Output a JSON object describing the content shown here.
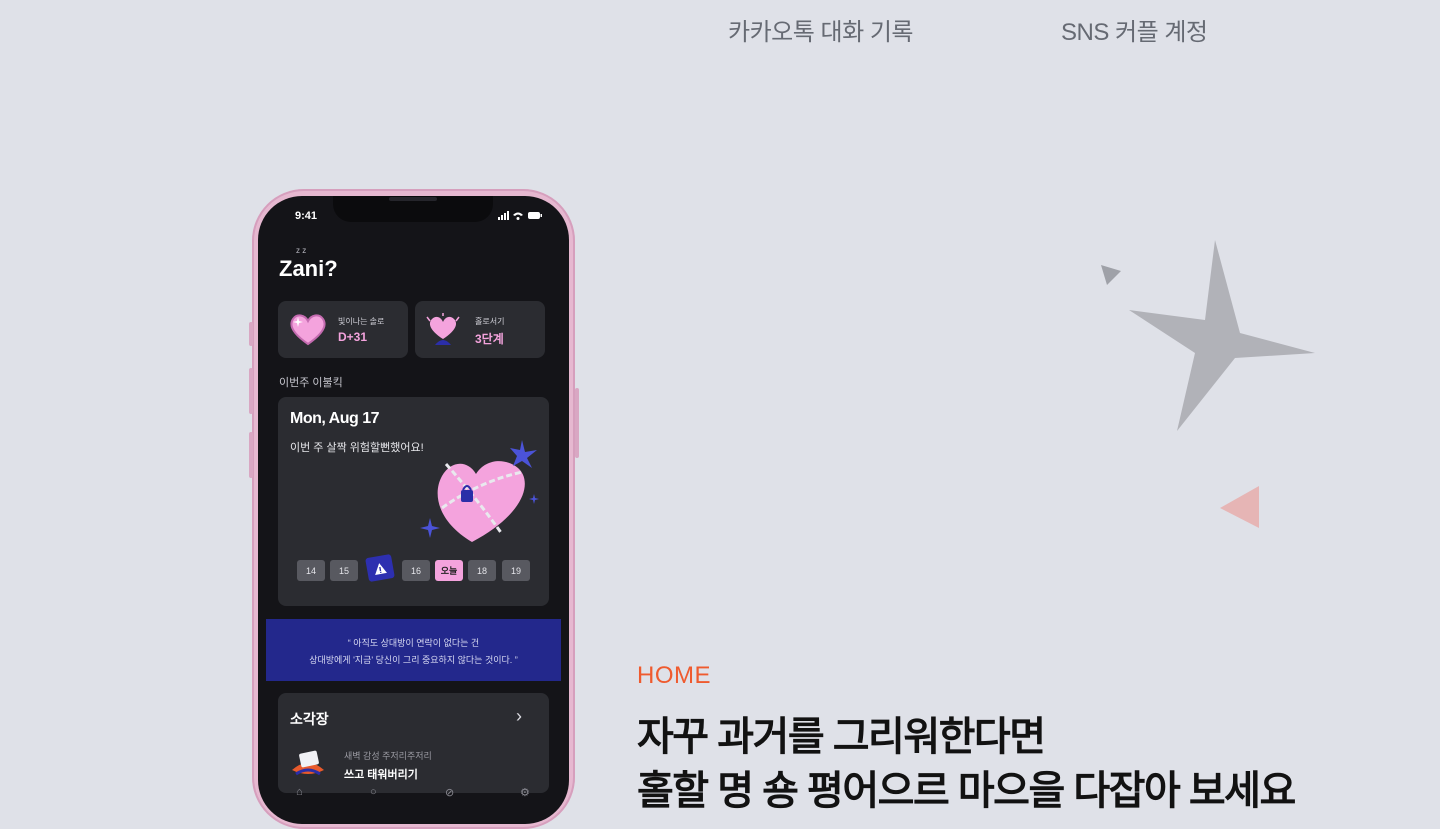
{
  "header": {
    "label_1": "카카오톡 대화 기록",
    "label_2": "SNS 커플 계정"
  },
  "section": {
    "label": "HOME",
    "headline_line1": "자꾸 과거를 그리워한다면",
    "headline_line2": "홀할 명 숑 평어으르 마으을 다잡아 보세요"
  },
  "phone": {
    "status_time": "9:41",
    "status_icons": "signal-wifi-battery",
    "app_title": "Zani?",
    "zz": "z z",
    "cards": [
      {
        "label": "빛이나는 솔로",
        "value": "D+31",
        "icon": "heart-glow-icon"
      },
      {
        "label": "홀로서기",
        "value": "3단계",
        "icon": "heart-sprout-icon"
      }
    ],
    "week_title": "이번주 이불킥",
    "date_title": "Mon, Aug 17",
    "date_sub": "이번 주 살짝 위험할뻔했어요!",
    "days": [
      {
        "label": "14",
        "state": "normal"
      },
      {
        "label": "15",
        "state": "normal"
      },
      {
        "label": "!",
        "state": "warning"
      },
      {
        "label": "16",
        "state": "normal"
      },
      {
        "label": "오늘",
        "state": "today"
      },
      {
        "label": "18",
        "state": "normal"
      },
      {
        "label": "19",
        "state": "normal"
      }
    ],
    "quote_line1": "“ 아직도 상대방이 연락이 없다는 건",
    "quote_line2": "상대방에게 '지금' 당신이 그리 중요하지 않다는 것이다. ”",
    "list_title": "소각장",
    "item_sub": "새벽 감성 주저리주저리",
    "item_title": "쓰고 태워버리기"
  },
  "colors": {
    "background": "#dfe1e8",
    "accent_orange": "#ef5a2e",
    "phone_frame": "#e6b8d0",
    "pink": "#f4a3dd",
    "blue_quote": "#23288c"
  }
}
